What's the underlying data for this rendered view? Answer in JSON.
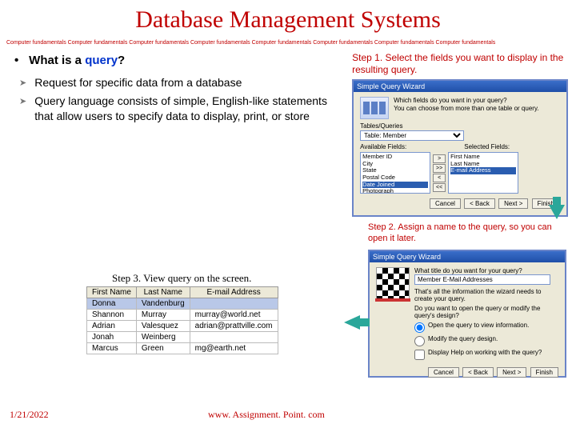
{
  "title": "Database Management Systems",
  "tagline": "Computer fundamentals Computer fundamentals Computer fundamentals Computer fundamentals Computer fundamentals Computer fundamentals Computer fundamentals Computer fundamentals",
  "heading_prefix": "What is a ",
  "heading_em": "query",
  "heading_suffix": "?",
  "bullets": [
    "Request for specific data from a database",
    "Query language consists of simple, English-like statements that allow users to specify data to display, print, or store"
  ],
  "step1": "Step 1.  Select the fields you want to display in the resulting query.",
  "wizard1": {
    "title": "Simple Query Wizard",
    "prompt1": "Which fields do you want in your query?",
    "prompt2": "You can choose from more than one table or query.",
    "tables_label": "Tables/Queries",
    "table_selected": "Table: Member",
    "avail_label": "Available Fields:",
    "sel_label": "Selected Fields:",
    "avail": [
      "Member ID",
      "City",
      "State",
      "Postal Code",
      "Date Joined",
      "Photograph"
    ],
    "sel": [
      "First Name",
      "Last Name",
      "E-mail Address"
    ],
    "btn_cancel": "Cancel",
    "btn_back": "< Back",
    "btn_next": "Next >",
    "btn_finish": "Finish"
  },
  "step2": "Step 2.  Assign a name to the query, so you can open it later.",
  "wizard2": {
    "title": "Simple Query Wizard",
    "q": "What title do you want for your query?",
    "value": "Member E-Mail Addresses",
    "done": "That's all the information the wizard needs to create your query.",
    "ask": "Do you want to open the query or modify the query's design?",
    "opt1": "Open the query to view information.",
    "opt2": "Modify the query design.",
    "help": "Display Help on working with the query?",
    "btn_cancel": "Cancel",
    "btn_back": "< Back",
    "btn_next": "Next >",
    "btn_finish": "Finish"
  },
  "step3": "Step 3.  View query on the screen.",
  "table": {
    "cols": [
      "First Name",
      "Last Name",
      "E-mail Address"
    ],
    "rows": [
      [
        "Donna",
        "Vandenburg",
        ""
      ],
      [
        "Shannon",
        "Murray",
        "murray@world.net"
      ],
      [
        "Adrian",
        "Valesquez",
        "adrian@prattville.com"
      ],
      [
        "Jonah",
        "Weinberg",
        ""
      ],
      [
        "Marcus",
        "Green",
        "mg@earth.net"
      ]
    ]
  },
  "footer_date": "1/21/2022",
  "footer_url": "www. Assignment. Point. com"
}
